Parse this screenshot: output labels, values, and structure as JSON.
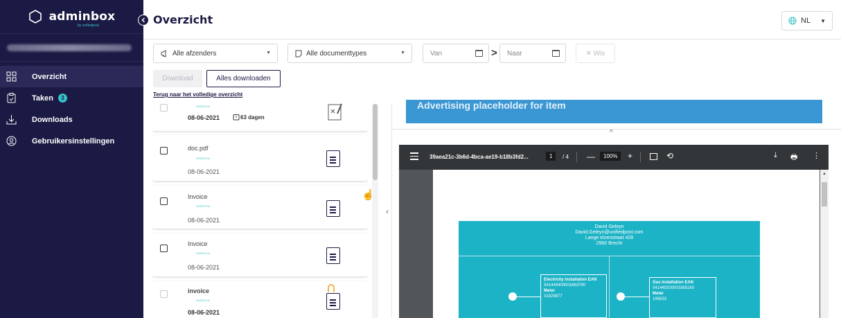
{
  "brand": {
    "name": "adminbox",
    "sub": "by unifiedpost"
  },
  "sidebar": {
    "items": [
      {
        "label": "Overzicht",
        "icon": "grid-icon",
        "active": true
      },
      {
        "label": "Taken",
        "icon": "clipboard-icon",
        "badge": "3"
      },
      {
        "label": "Downloads",
        "icon": "download-icon"
      },
      {
        "label": "Gebruikersinstellingen",
        "icon": "user-settings-icon"
      }
    ]
  },
  "header": {
    "title": "Overzicht",
    "language": "NL"
  },
  "filters": {
    "senders": "Alle afzenders",
    "doctypes": "Alle documenttypes",
    "from_placeholder": "Van",
    "to_placeholder": "Naar",
    "clear": "✕ Wis"
  },
  "actions": {
    "download": "Download",
    "download_all": "Alles downloaden",
    "back_link": "Terug naar het volledige overzicht"
  },
  "documents": [
    {
      "title": "",
      "sender": "ENERGIA",
      "date": "08-06-2021",
      "days": "63 dagen"
    },
    {
      "title": "doc.pdf",
      "sender": "ENERGIA",
      "date": "08-06-2021"
    },
    {
      "title": "Invoice",
      "sender": "ENERGIA",
      "date": "08-06-2021"
    },
    {
      "title": "Invoice",
      "sender": "ENERGIA",
      "date": "08-06-2021"
    },
    {
      "title": "invoice",
      "sender": "ENERGIA",
      "date": "08-06-2021"
    }
  ],
  "preview": {
    "banner": "Advertising placeholder for item",
    "pdf": {
      "filename": "39aea21c-3b6d-4bca-ae19-b18b3fd2...",
      "page": "1",
      "pages": "/ 4",
      "zoom": "100%"
    },
    "content": {
      "name": "David Geleyn",
      "email": "David.Geleyn@unifiedpost.com",
      "street": "Lange elzenstraat 428",
      "city": "2960 Brecht",
      "elec_title": "Electricity installation EAN",
      "elec_ean": "541449400001863790",
      "elec_meter_label": "Meter",
      "elec_meter": "31929877",
      "gas_title": "Gas installation EAN",
      "gas_ean": "541449200003365160",
      "gas_meter_label": "Meter",
      "gas_meter": "195633"
    }
  },
  "colors": {
    "sidebar": "#1b1a44",
    "accent": "#36c1c8",
    "banner": "#3a97d4",
    "teal": "#1cb3c6"
  }
}
